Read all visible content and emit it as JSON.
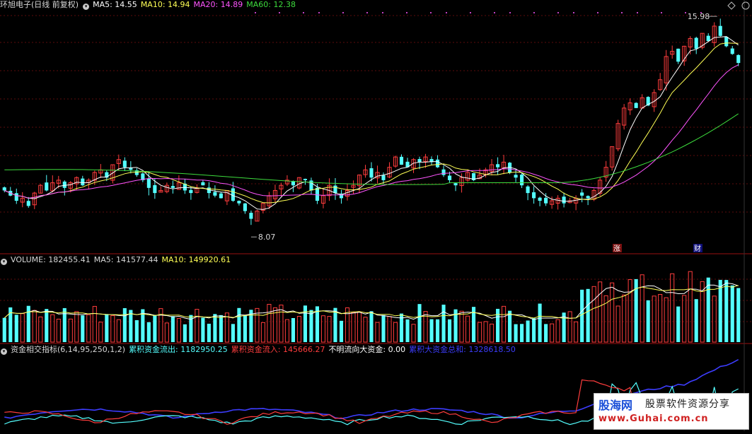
{
  "colors": {
    "background": "#000000",
    "up": "#ff3d3d",
    "down": "#54ffff",
    "ma5": "#ffffff",
    "ma10": "#ffff55",
    "ma20": "#ff55ff",
    "ma60": "#3ddc3d",
    "grid": "#7a1010",
    "separator": "#9a1010",
    "outflow": "#54ffff",
    "inflow": "#ff3d3d",
    "bigfund": "#3d3dff"
  },
  "price_panel": {
    "title": "环旭电子(日线 前复权)",
    "ma5": "MA5: 14.55",
    "ma10": "MA10: 14.94",
    "ma20": "MA20: 14.89",
    "ma60": "MA60: 12.38",
    "high_label": "15.98",
    "low_label": "8.07",
    "tag_zhang": "涨",
    "tag_cai": "财",
    "collapse_icon": "chevron-down-icon",
    "corner_icons": [
      "diamond-icon",
      "circle-icon"
    ]
  },
  "volume_panel": {
    "title": "VOLUME: 182455.41",
    "ma5": "MA5: 141577.44",
    "ma10": "MA10: 149920.61"
  },
  "fund_panel": {
    "title": "资金相交指标(6,14,95,250,1,2)",
    "outflow": "累积资金流出: 1182950.25",
    "inflow": "累积资金流入: 145666.27",
    "unknown": "不明流向大资金: 0.00",
    "bigsum": "累积大资金总和: 1328618.50"
  },
  "watermark": {
    "line1a": "股海网",
    "line1b": "股票软件资源分享",
    "line2": "www.Guhai.com.cn"
  },
  "chart_data": {
    "type": "candlestick",
    "title": "环旭电子(日线 前复权)",
    "price_range": [
      7.5,
      16.5
    ],
    "series_close": [
      9.6,
      9.4,
      9.2,
      9.3,
      9.0,
      9.5,
      9.8,
      9.6,
      9.9,
      10.0,
      9.7,
      9.9,
      10.1,
      9.8,
      10.0,
      10.3,
      10.4,
      10.1,
      10.6,
      10.8,
      10.5,
      10.4,
      10.2,
      10.0,
      9.7,
      9.5,
      9.6,
      9.8,
      9.7,
      9.9,
      9.6,
      9.5,
      9.7,
      9.8,
      9.5,
      9.4,
      9.3,
      9.6,
      9.2,
      9.1,
      8.8,
      8.5,
      8.8,
      9.1,
      9.4,
      9.6,
      9.8,
      10.0,
      9.8,
      10.1,
      10.0,
      9.6,
      9.2,
      9.4,
      9.8,
      9.5,
      9.3,
      9.6,
      9.8,
      10.2,
      10.4,
      10.1,
      10.3,
      10.0,
      10.5,
      10.9,
      10.6,
      10.5,
      10.8,
      10.7,
      10.9,
      10.7,
      10.5,
      10.2,
      10.0,
      9.8,
      10.1,
      10.3,
      10.0,
      10.2,
      10.4,
      10.6,
      10.5,
      10.7,
      10.3,
      10.1,
      9.8,
      9.5,
      9.3,
      9.2,
      9.1,
      9.2,
      9.3,
      9.1,
      9.2,
      9.3,
      9.4,
      9.3,
      9.6,
      10.0,
      10.5,
      11.3,
      12.2,
      12.8,
      13.0,
      12.8,
      13.2,
      12.9,
      13.4,
      13.9,
      14.8,
      15.0,
      14.6,
      15.2,
      15.5,
      15.1,
      15.7,
      15.4,
      15.98,
      15.6,
      15.2,
      14.9,
      14.55
    ],
    "ma60_last": 12.38,
    "volume_last": 182455.41,
    "volume_ma5": 141577.44,
    "volume_ma10": 149920.61,
    "fund_series": [
      "累积资金流出",
      "累积资金流入",
      "不明流向大资金",
      "累积大资金总和"
    ]
  }
}
